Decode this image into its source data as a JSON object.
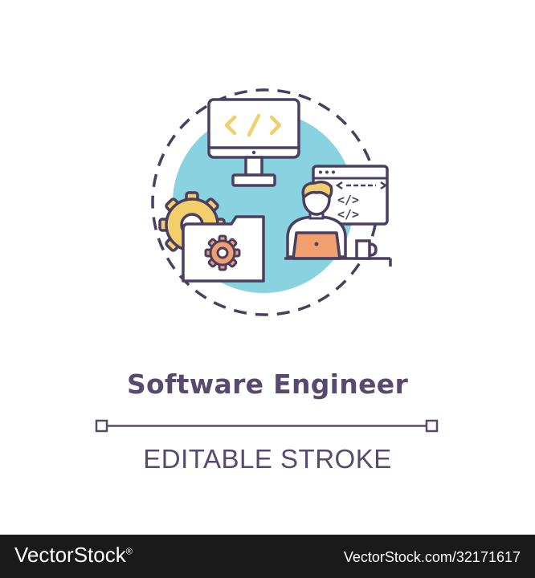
{
  "title": "Software Engineer",
  "subtitle": "EDITABLE STROKE",
  "footer": {
    "brand": "VectorStock",
    "registered_mark": "®",
    "image_id": "VectorStock.com/32171617"
  },
  "icons": [
    "code-monitor-icon",
    "gear-icon",
    "settings-folder-icon",
    "programmer-laptop-icon",
    "code-window-icon",
    "coffee-mug-icon"
  ],
  "colors": {
    "outline": "#4a3f60",
    "accent_blue": "#88d3df",
    "accent_yellow": "#f2cf6c",
    "accent_orange": "#f19f6f",
    "footer_bg": "#1a1a1a"
  }
}
